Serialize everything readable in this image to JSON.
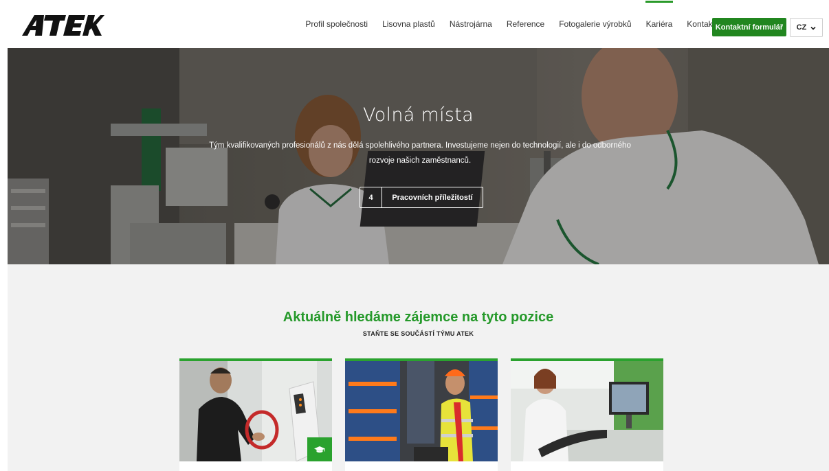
{
  "header": {
    "logo_text": "ATEK",
    "nav": [
      {
        "label": "Profil společnosti",
        "active": false
      },
      {
        "label": "Lisovna plastů",
        "active": false
      },
      {
        "label": "Nástrojárna",
        "active": false
      },
      {
        "label": "Reference",
        "active": false
      },
      {
        "label": "Fotogalerie výrobků",
        "active": false
      },
      {
        "label": "Kariéra",
        "active": true
      },
      {
        "label": "Kontakty",
        "active": false
      }
    ],
    "cta_label": "Kontaktní formulář",
    "language": "CZ"
  },
  "hero": {
    "title": "Volná místa",
    "text": "Tým kvalifikovaných profesionálů z nás dělá spolehlivého partnera. Investujeme nejen do technologií, ale i do odborného rozvoje našich zaměstnanců.",
    "button_count": "4",
    "button_label": "Pracovních příležitostí"
  },
  "positions": {
    "title": "Aktuálně hledáme zájemce na tyto pozice",
    "subtitle": "STAŇTE SE SOUČÁSTÍ TÝMU ATEK",
    "cards": [
      {
        "image": "operator-at-machine-photo",
        "badge_icon": "graduation-cap-icon"
      },
      {
        "image": "warehouse-worker-photo"
      },
      {
        "image": "quality-worker-photo"
      }
    ]
  },
  "colors": {
    "brand_green": "#21861f",
    "accent_green": "#2aa22e",
    "title_green": "#25992a"
  }
}
